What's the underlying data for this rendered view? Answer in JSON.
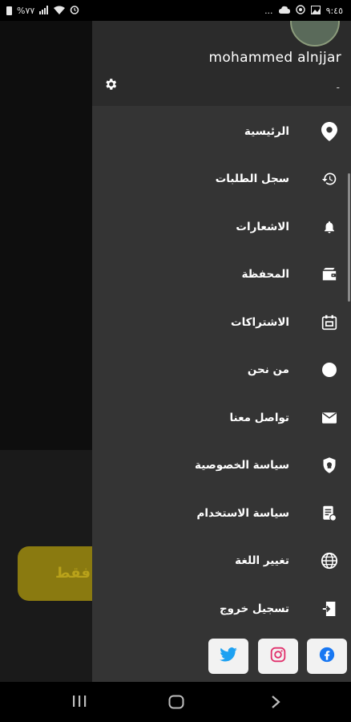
{
  "status_bar": {
    "left_text": "%٧٧",
    "dots": "...",
    "time": "٩:٤٥"
  },
  "backdrop": {
    "button_text": "فقط"
  },
  "drawer": {
    "username": "mohammed alnjjar",
    "user_subtext": "-",
    "menu_items": [
      {
        "label": "الرئيسية",
        "icon": "location-pin-icon"
      },
      {
        "label": "سجل الطلبات",
        "icon": "history-icon"
      },
      {
        "label": "الاشعارات",
        "icon": "bell-icon"
      },
      {
        "label": "المحفظة",
        "icon": "wallet-icon"
      },
      {
        "label": "الاشتراكات",
        "icon": "subscriptions-icon"
      },
      {
        "label": "من نحن",
        "icon": "circle-info-icon"
      },
      {
        "label": "تواصل معنا",
        "icon": "mail-icon"
      },
      {
        "label": "سياسة الخصوصية",
        "icon": "shield-icon"
      },
      {
        "label": "سياسة الاستخدام",
        "icon": "document-icon"
      },
      {
        "label": "تغيير اللغة",
        "icon": "globe-icon"
      },
      {
        "label": "تسجيل خروج",
        "icon": "logout-icon"
      }
    ],
    "social": [
      {
        "name": "twitter",
        "color": "#1DA1F2"
      },
      {
        "name": "instagram",
        "color": "#E1306C"
      },
      {
        "name": "facebook",
        "color": "#1877F2"
      }
    ]
  },
  "colors": {
    "drawer_bg": "#343434",
    "header_bg": "#2b2b2b",
    "accent_yellow": "#8a7a10"
  }
}
